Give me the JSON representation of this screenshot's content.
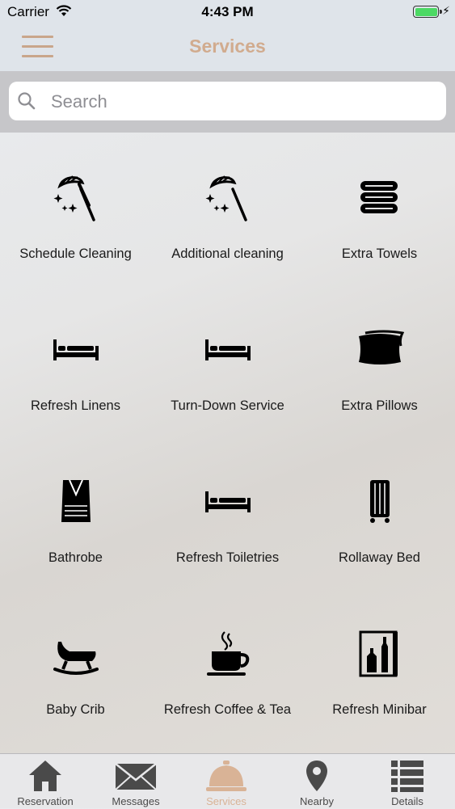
{
  "status_bar": {
    "carrier": "Carrier",
    "time": "4:43 PM"
  },
  "nav": {
    "title": "Services",
    "menu_icon": "hamburger-menu-icon"
  },
  "search": {
    "placeholder": "Search",
    "value": ""
  },
  "accent_color": "#d1ab8e",
  "services": [
    {
      "label": "Schedule Cleaning",
      "icon": "feather-duster-icon"
    },
    {
      "label": "Additional cleaning",
      "icon": "feather-duster-icon"
    },
    {
      "label": "Extra Towels",
      "icon": "towel-stack-icon"
    },
    {
      "label": "Refresh Linens",
      "icon": "bed-icon"
    },
    {
      "label": "Turn-Down Service",
      "icon": "bed-icon"
    },
    {
      "label": "Extra Pillows",
      "icon": "pillow-icon"
    },
    {
      "label": "Bathrobe",
      "icon": "bathrobe-icon"
    },
    {
      "label": "Refresh Toiletries",
      "icon": "bed-icon"
    },
    {
      "label": "Rollaway Bed",
      "icon": "rollaway-bed-icon"
    },
    {
      "label": "Baby Crib",
      "icon": "baby-crib-icon"
    },
    {
      "label": "Refresh Coffee & Tea",
      "icon": "coffee-cup-icon"
    },
    {
      "label": "Refresh Minibar",
      "icon": "minibar-icon"
    }
  ],
  "tabs": [
    {
      "label": "Reservation",
      "icon": "home-icon",
      "active": false
    },
    {
      "label": "Messages",
      "icon": "envelope-icon",
      "active": false
    },
    {
      "label": "Services",
      "icon": "service-bell-icon",
      "active": true
    },
    {
      "label": "Nearby",
      "icon": "map-pin-icon",
      "active": false
    },
    {
      "label": "Details",
      "icon": "list-icon",
      "active": false
    }
  ]
}
